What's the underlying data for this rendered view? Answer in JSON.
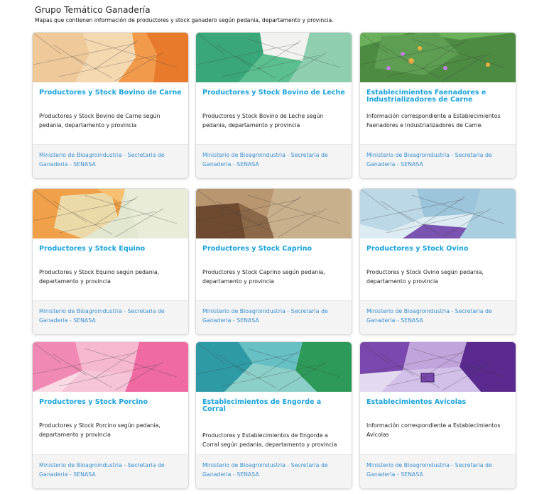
{
  "header": {
    "title": "Grupo Temático Ganadería",
    "subtitle": "Mapas que contienen información de productores y stock ganadero según pedania, departamento y provincia."
  },
  "cards": [
    {
      "title": "Productores y Stock Bovino de Carne",
      "description": "Productores y Stock Bovino de Carne según pedania, departamento y provincia",
      "source": "Ministerio de Bioagroindustria - Secretaria de Ganaderia - SENASA",
      "map_colors": [
        "#efc99a",
        "#e87a2c",
        "#f29a4c",
        "#e9e2d6"
      ]
    },
    {
      "title": "Productores y Stock Bovino de Leche",
      "description": "Productores y Stock Bovino de Leche según pedania, departamento y provincia",
      "source": "Ministerio de Bioagroindustria - Secretaria de Ganaderia - SENASA",
      "map_colors": [
        "#3aa77a",
        "#5bbf8f",
        "#cfe3d2",
        "#8fcfb0"
      ]
    },
    {
      "title": "Establecimientos Faenadores e Industrializadores de Carne",
      "description": "Información correspondiente a Establecimientos Faenadores e Industrializadores de Carne.",
      "source": "Ministerio de Bioagroindustria - Secretaria de Ganaderia - SENASA",
      "map_colors": [
        "#6bb05a",
        "#4d8a42",
        "#f0b040",
        "#c080e0"
      ]
    },
    {
      "title": "Productores y Stock Equino",
      "description": "Productores y Stock Equino según pedania, departamento y provincia",
      "source": "Ministerio de Bioagroindustria - Secretaria de Ganaderia - SENASA",
      "map_colors": [
        "#f0a048",
        "#ecd9a8",
        "#e2e8d0",
        "#f6c070"
      ]
    },
    {
      "title": "Productores y Stock Caprino",
      "description": "Productores y Stock Caprino según pedania, departamento y provincia",
      "source": "Ministerio de Bioagroindustria - Secretaria de Ganaderia - SENASA",
      "map_colors": [
        "#8a6848",
        "#b89670",
        "#d8c4a4",
        "#6e4a30"
      ]
    },
    {
      "title": "Productores y Stock Ovino",
      "description": "Productores y Stock Ovino según pedania, departamento y provincia",
      "source": "Ministerio de Bioagroindustria - Secretaria de Ganaderia - SENASA",
      "map_colors": [
        "#bcd8e6",
        "#9cc4da",
        "#dcecf2",
        "#7a52b0"
      ]
    },
    {
      "title": "Productores y Stock Porcino",
      "description": "Productores y Stock Porcino según pedania, departamento y provincia",
      "source": "Ministerio de Bioagroindustria - Secretaria de Ganaderia - SENASA",
      "map_colors": [
        "#f08ab4",
        "#f6b8d0",
        "#ee6aa0",
        "#fadbe6"
      ]
    },
    {
      "title": "Establecimientos de Engorde a Corral",
      "description": "Productores y Establecimientos de Engorde a Corral según pedania, departamento y provincia",
      "source": "Ministerio de Bioagroindustria - Secretaria de Ganaderia - SENASA",
      "map_colors": [
        "#2e9aa6",
        "#66c0c4",
        "#b8dfdc",
        "#2e9a5a"
      ]
    },
    {
      "title": "Establecimientos Avícolas",
      "description": "Información correspondiente a Establecimientos Avícolas",
      "source": "Ministerio de Bioagroindustria - Secretaria de Ganaderia - SENASA",
      "map_colors": [
        "#7a48ae",
        "#c2a4dc",
        "#e4daf0",
        "#5a2a8e"
      ]
    }
  ]
}
